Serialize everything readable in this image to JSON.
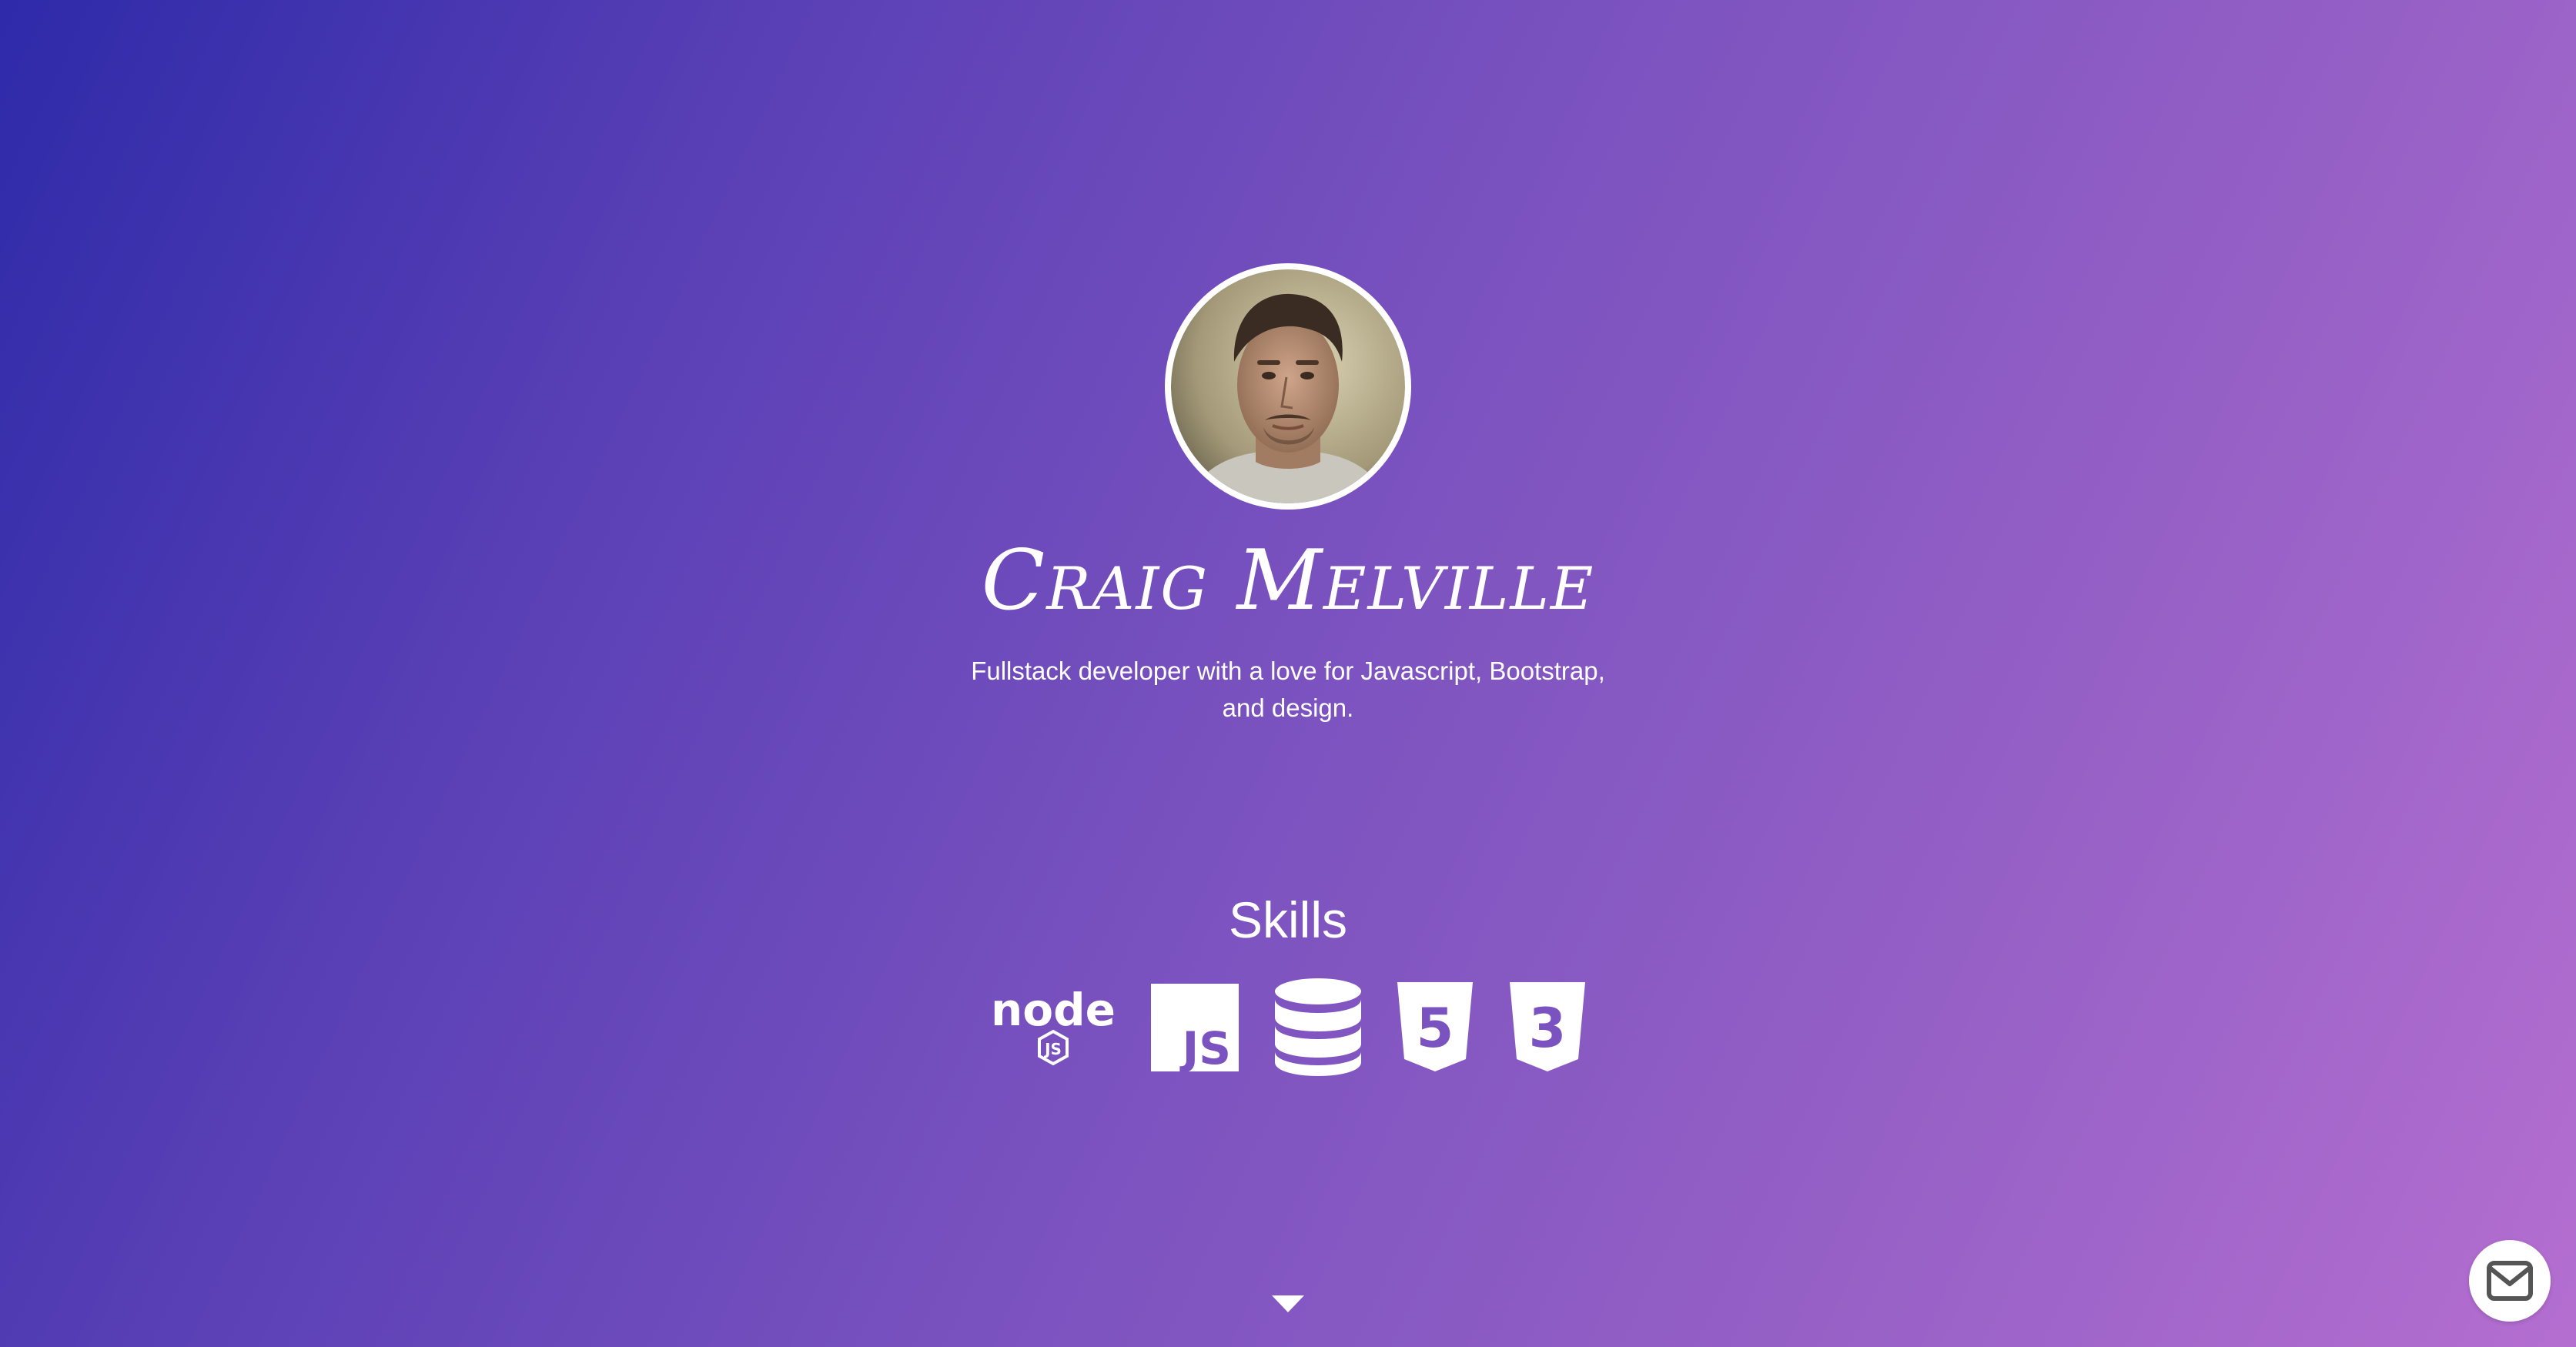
{
  "profile": {
    "name": "Craig Melville",
    "tagline_line1": "Fullstack developer with a love for Javascript, Bootstrap,",
    "tagline_line2": "and design."
  },
  "skills": {
    "title": "Skills",
    "items": [
      {
        "label": "node",
        "sub": "JS",
        "icon": "nodejs-icon"
      },
      {
        "label": "JS",
        "icon": "javascript-icon"
      },
      {
        "icon": "database-icon"
      },
      {
        "label": "5",
        "icon": "html5-icon"
      },
      {
        "label": "3",
        "icon": "css3-icon"
      }
    ]
  },
  "icons": {
    "scroll": "caret-down-icon",
    "contact": "envelope-icon"
  },
  "colors": {
    "gradient_start": "#2e2aa9",
    "gradient_end": "#b46ed0",
    "icon_cutout": "#7b53c0",
    "mail_icon": "#555555"
  }
}
